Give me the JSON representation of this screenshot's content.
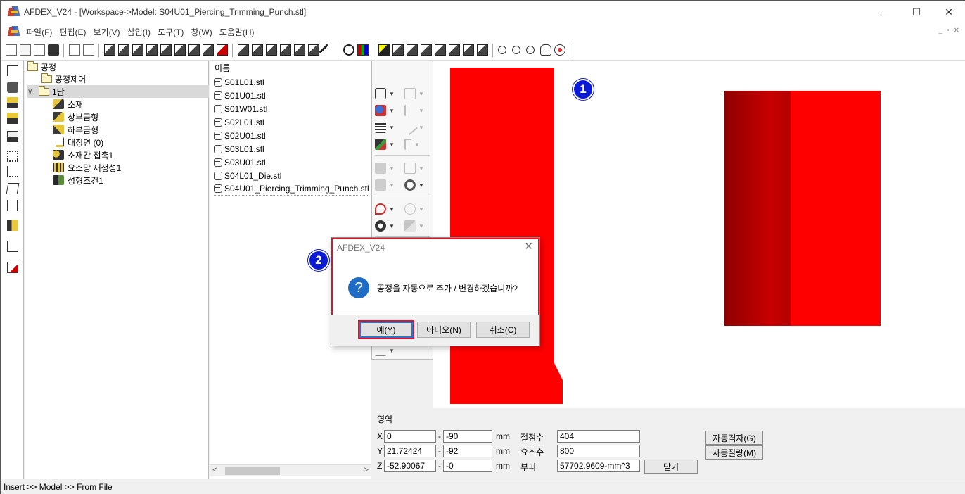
{
  "window": {
    "title": "AFDEX_V24 - [Workspace->Model: S04U01_Piercing_Trimming_Punch.stl]",
    "controls": [
      "—",
      "☐",
      "✕"
    ]
  },
  "menu": [
    "파일(F)",
    "편집(E)",
    "보기(V)",
    "삽입(I)",
    "도구(T)",
    "창(W)",
    "도움말(H)"
  ],
  "tree": {
    "root": "공정",
    "items": [
      {
        "label": "공정제어",
        "icon": "folder-icon"
      },
      {
        "label": "1단",
        "icon": "folder-icon"
      },
      {
        "label": "소재",
        "icon": "material-icon"
      },
      {
        "label": "상부금형",
        "icon": "upper-die-icon"
      },
      {
        "label": "하부금형",
        "icon": "lower-die-icon"
      },
      {
        "label": "대칭면 (0)",
        "icon": "symmetry-plane-icon"
      },
      {
        "label": "소재간 접촉1",
        "icon": "contact-icon"
      },
      {
        "label": "요소망 재생성1",
        "icon": "remesh-icon"
      },
      {
        "label": "성형조건1",
        "icon": "forming-condition-icon"
      }
    ]
  },
  "filelist": {
    "header": "이름",
    "files": [
      "S01L01.stl",
      "S01U01.stl",
      "S01W01.stl",
      "S02L01.stl",
      "S02U01.stl",
      "S03L01.stl",
      "S03U01.stl",
      "S04L01_Die.stl",
      "S04U01_Piercing_Trimming_Punch.stl"
    ]
  },
  "viewport": {
    "badge1": "1",
    "badge2": "2",
    "colors": {
      "shape": "#ff0000",
      "shape_dark": "#8e0000",
      "badge": "#0a1ad6"
    }
  },
  "props": {
    "section_label": "영역",
    "x_label": "X",
    "x_min": "0",
    "x_max": "-90",
    "y_label": "Y",
    "y_min": "21.72424",
    "y_max": "-92",
    "z_label": "Z",
    "z_min": "-52.90067",
    "z_max": "-0",
    "unit": "mm",
    "dash": "-",
    "nodes_label": "절점수",
    "nodes_value": "404",
    "elements_label": "요소수",
    "elements_value": "800",
    "volume_label": "부피",
    "volume_value": "57702.9609-mm^3",
    "auto_mesh_button": "자동격자(G)",
    "auto_mass_button": "자동질량(M)",
    "close_button": "닫기"
  },
  "status": "Insert >> Model >> From File",
  "dialog": {
    "title": "AFDEX_V24",
    "close": "✕",
    "icon": "?",
    "message": "공정을 자동으로 추가 / 변경하겠습니까?",
    "yes": "예(Y)",
    "no": "아니오(N)",
    "cancel": "취소(C)",
    "highlight_color": "#e0122a"
  }
}
